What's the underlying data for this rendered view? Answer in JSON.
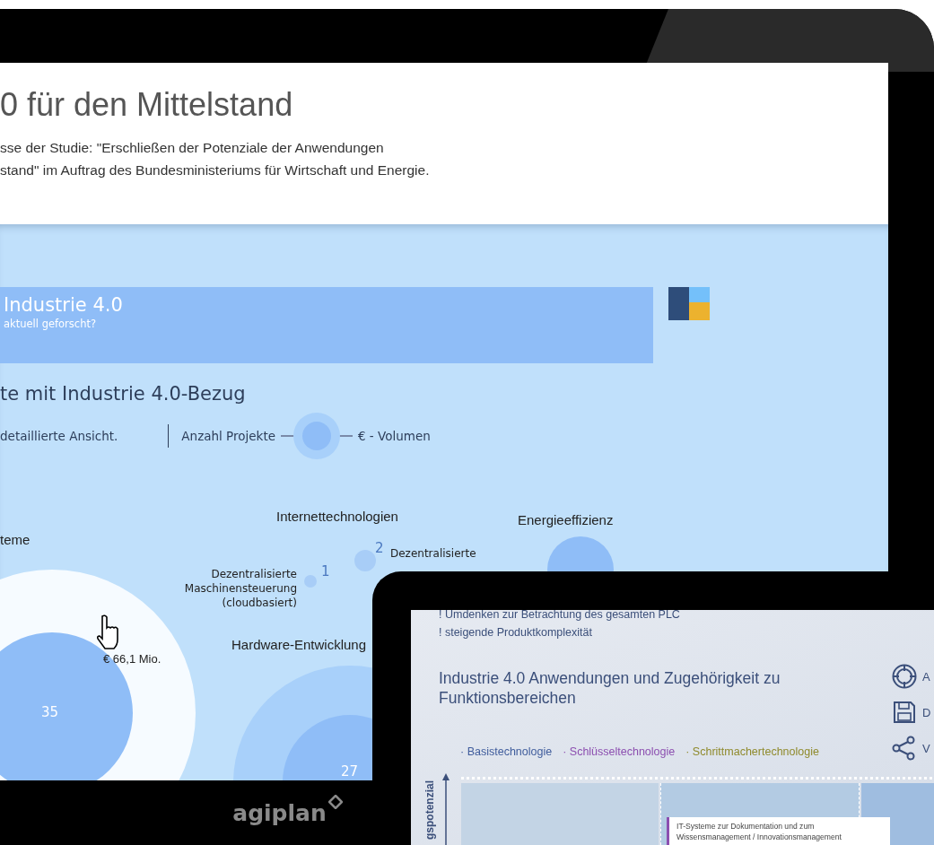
{
  "desktop": {
    "header": {
      "title": "0 für den Mittelstand",
      "subtitle_lines": [
        "sse der Studie: \"Erschließen der Potenziale der Anwendungen",
        "stand\" im Auftrag des Bundesministeriums für Wirtschaft und Energie."
      ]
    },
    "banner": {
      "title": "Industrie 4.0",
      "subtitle": "aktuell geforscht?"
    },
    "section": {
      "title": "te mit Industrie 4.0-Bezug",
      "hint": "detaillierte Ansicht.",
      "count_label": "Anzahl Projekte",
      "volume_label": "€ - Volumen"
    },
    "bubble_chart": {
      "category_labels": [
        "teme",
        "Internettechnologien",
        "Energieeffizienz",
        "Hardware-Entwicklung"
      ],
      "counts": [
        "35",
        "27",
        "1",
        "2"
      ],
      "project_labels": [
        "Dezentralisierte\nMaschinensteuerung\n(cloudbasiert)",
        "Dezentralisierte"
      ],
      "volume_tooltip": "€ 66,1 Mio."
    },
    "brand": "agiplan"
  },
  "tablet": {
    "bullets": [
      "! Umdenken zur Betrachtung des gesamten PLC",
      "! steigende Produktkomplexität"
    ],
    "title": "Industrie 4.0 Anwendungen und Zugehörigkeit zu Funktionsbereichen",
    "legend": [
      {
        "label": "· Basistechnologie",
        "color": "#3f5c9c"
      },
      {
        "label": "· Schlüsseltechnologie",
        "color": "#8c4fb0"
      },
      {
        "label": "· Schrittmachertechnologie",
        "color": "#8f8a2c"
      }
    ],
    "actions": [
      {
        "kind": "target",
        "label": "A"
      },
      {
        "kind": "save",
        "label": "D"
      },
      {
        "kind": "share",
        "label": "V"
      }
    ],
    "axis_label": "gspotenzial",
    "note": "IT-Systeme zur Dokumentation und zum Wissensmanagement / Innovationsmanagement"
  }
}
